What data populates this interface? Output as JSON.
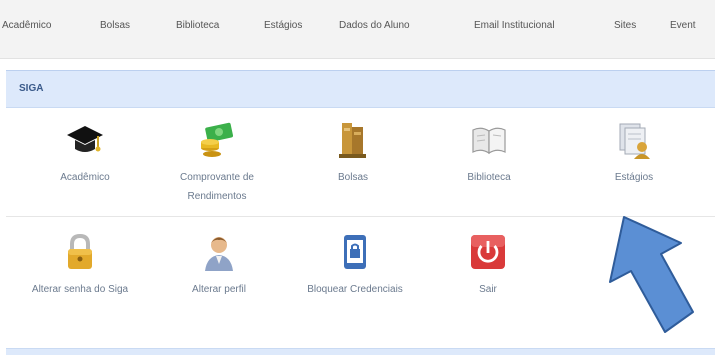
{
  "top_nav": {
    "items": [
      "Acadêmico",
      "Bolsas",
      "Biblioteca",
      "Estágios",
      "Dados do Aluno",
      "Email Institucional",
      "Sites",
      "Event"
    ]
  },
  "panel": {
    "title": "SIGA"
  },
  "row1": [
    {
      "label": "Acadêmico",
      "icon": "graduation-cap-icon"
    },
    {
      "label": "Comprovante de Rendimentos",
      "icon": "money-icon"
    },
    {
      "label": "Bolsas",
      "icon": "books-icon"
    },
    {
      "label": "Biblioteca",
      "icon": "open-book-icon"
    },
    {
      "label": "Estágios",
      "icon": "documents-user-icon"
    }
  ],
  "row2": [
    {
      "label": "Alterar senha do Siga",
      "icon": "lock-icon"
    },
    {
      "label": "Alterar perfil",
      "icon": "user-profile-icon"
    },
    {
      "label": "Bloquear Credenciais",
      "icon": "lock-device-icon"
    },
    {
      "label": "Sair",
      "icon": "power-icon"
    }
  ],
  "annotation": {
    "icon": "blue-arrow-icon",
    "color": "#5b8fd4"
  }
}
